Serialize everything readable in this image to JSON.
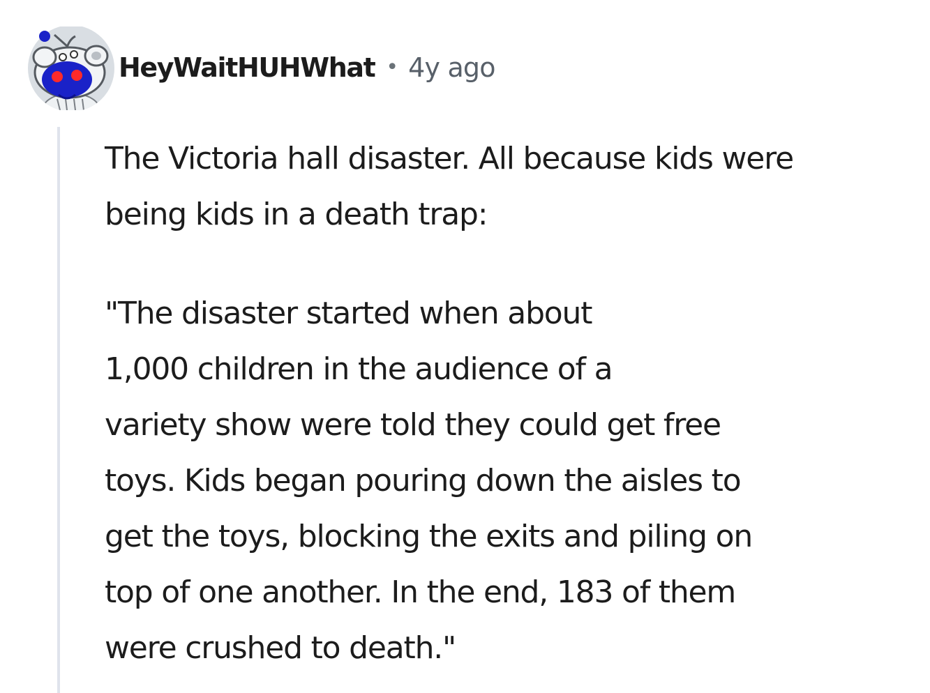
{
  "comment": {
    "author": "HeyWaitHUHWhat",
    "separator": "•",
    "timestamp": "4y ago",
    "avatar_icon": "snoo-avatar-icon",
    "paragraphs": [
      {
        "lines": [
          "The Victoria hall disaster. All because kids were",
          "being kids in a death trap:"
        ]
      },
      {
        "lines": [
          "\"The disaster started when about",
          "1,000 children in the audience of a",
          "variety show were told they could get free",
          "toys. Kids began pouring down the aisles to",
          "get the toys, blocking the exits and piling on",
          "top of one another. In the end, 183 of them",
          "were crushed to death.\""
        ]
      }
    ]
  },
  "colors": {
    "avatar_background": "#d7dde2",
    "avatar_face": "#1a22c8",
    "thread_line": "#dfe3ec",
    "text": "#1c1c1c",
    "meta_text": "#586069"
  }
}
